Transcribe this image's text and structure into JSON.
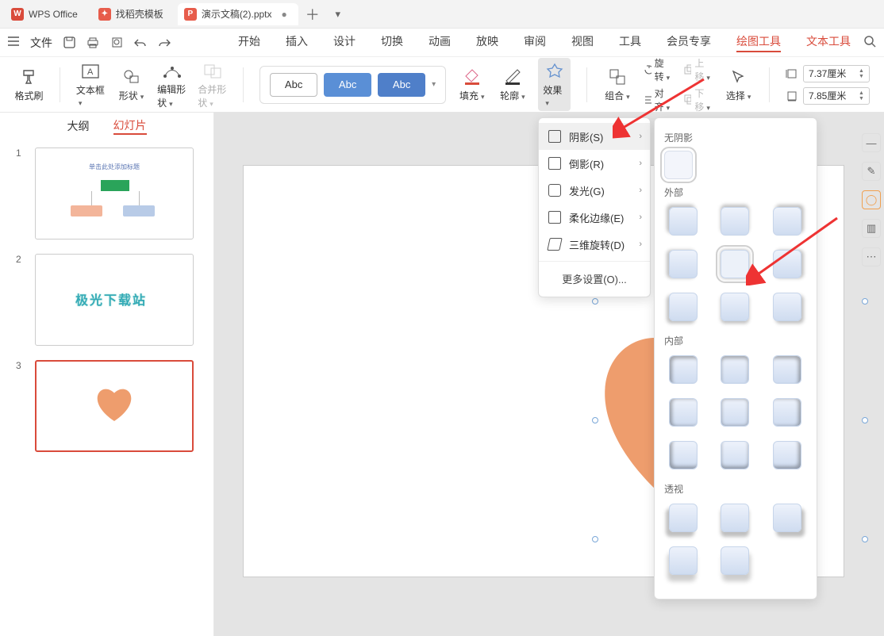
{
  "title_tabs": {
    "app": "WPS Office",
    "template": "找稻壳模板",
    "doc": "演示文稿(2).pptx"
  },
  "file_label": "文件",
  "ribbon_tabs": {
    "start": "开始",
    "insert": "插入",
    "design": "设计",
    "transition": "切换",
    "animation": "动画",
    "slideshow": "放映",
    "review": "审阅",
    "view": "视图",
    "tools": "工具",
    "member": "会员专享",
    "draw_tools": "绘图工具",
    "text_tools": "文本工具"
  },
  "ribbon": {
    "format_painter": "格式刷",
    "text_box": "文本框",
    "shapes": "形状",
    "edit_shape": "编辑形状",
    "merge_shape": "合并形状",
    "abc": "Abc",
    "fill": "填充",
    "outline": "轮廓",
    "effect": "效果",
    "combine": "组合",
    "rotate": "旋转",
    "align": "对齐",
    "up": "上移",
    "down": "下移",
    "select": "选择",
    "width": "7.37厘米",
    "height": "7.85厘米"
  },
  "side_tabs": {
    "outline": "大纲",
    "slides": "幻灯片"
  },
  "thumbs": {
    "t1_title": "单击此处添加标题",
    "t2_logo": "极光下载站"
  },
  "fx_menu": {
    "shadow": "阴影(S)",
    "reflection": "倒影(R)",
    "glow": "发光(G)",
    "soft_edge": "柔化边缘(E)",
    "rotate3d": "三维旋转(D)",
    "more": "更多设置(O)..."
  },
  "shadow_panel": {
    "none": "无阴影",
    "outer": "外部",
    "inner": "内部",
    "perspective": "透视"
  }
}
